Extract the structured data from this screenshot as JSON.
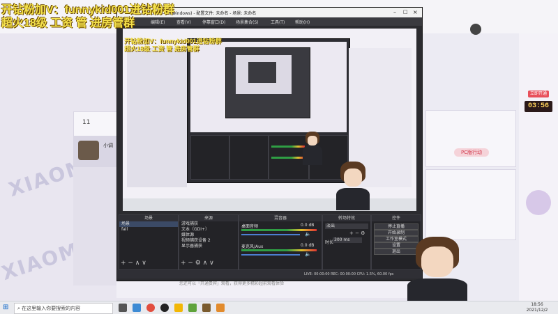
{
  "overlay": {
    "promo_line1": "开钻粉加V：funnykid001进钻粉群",
    "promo_line2": "超火18级 工资 管 进房管群"
  },
  "site": {
    "watermark": "XIAOMO",
    "right_panel": {
      "badge_label": "立即开通",
      "timer": "03:56",
      "pcb_label": "PC版行动"
    },
    "left_card": {
      "count": "11",
      "name_prefix": "小调"
    },
    "center_note": "您还可以「开通贵宾」观看，获得更多精彩超前观看体验"
  },
  "obs": {
    "title": "OBS 27.1.3 (64-bit, windows) - 配置文件: 未命名 - 场景: 未命名",
    "menus": [
      "文件(F)",
      "编辑(E)",
      "查看(V)",
      "停靠窗口(D)",
      "场景集合(S)",
      "工具(T)",
      "帮助(H)"
    ],
    "docks": {
      "scenes": {
        "title": "场景",
        "items": [
          "场景",
          "fall"
        ]
      },
      "sources": {
        "title": "来源",
        "items": [
          "游戏捕获",
          "文本（GDI+）",
          "媒体源",
          "视频捕获设备 2",
          "显示器捕获"
        ]
      },
      "mixer": {
        "title": "混音器",
        "channels": [
          {
            "name": "桌面音频",
            "db": "0.0 dB"
          },
          {
            "name": "麦克风/Aux",
            "db": "0.0 dB"
          }
        ]
      },
      "transitions": {
        "title": "转场特效",
        "type": "淡出",
        "duration_label": "时长",
        "duration_value": "300 ms"
      },
      "controls": {
        "title": "控件",
        "buttons": [
          "停止直播",
          "开始录制",
          "工作室模式",
          "设置",
          "退出"
        ]
      }
    },
    "status": "LIVE: 00:00:00   REC: 00:00:00   CPU: 1.5%, 60.00 fps"
  },
  "taskbar": {
    "search_placeholder": "在这里输入你要搜索的内容",
    "time": "18:56",
    "date": "2021/12/2"
  },
  "colors": {
    "promo": "#f4e14b",
    "obs_bg": "#2b2b2f",
    "site_bg": "#e9e6f0"
  }
}
